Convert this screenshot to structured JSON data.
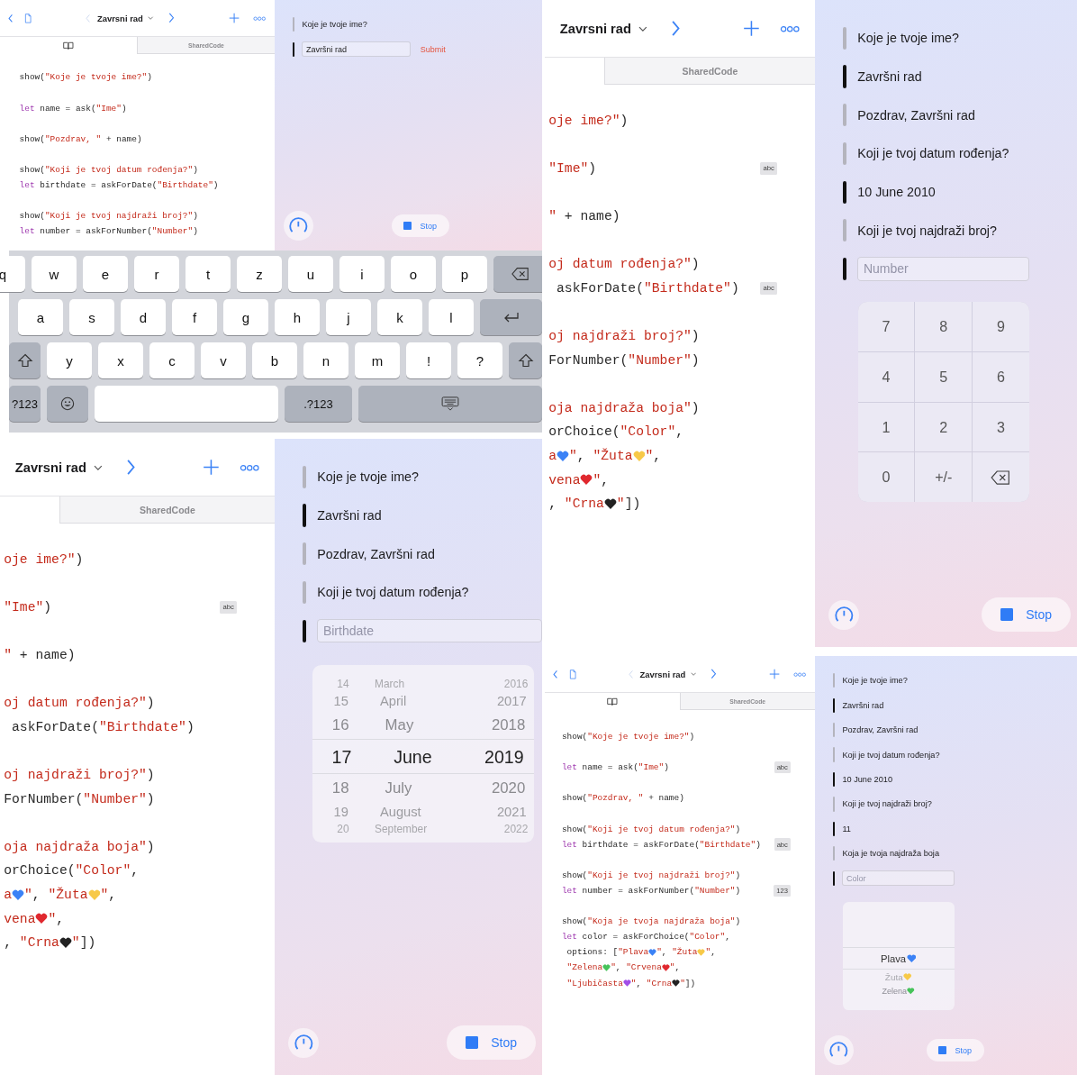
{
  "panels": [
    {
      "editor": {
        "leading_icons": true,
        "title": "Zavrsni rad",
        "tabs": [
          {
            "kind": "book",
            "selected": true
          },
          {
            "kind": "file",
            "label": "SharedCode",
            "selected": false
          }
        ],
        "blocks": [
          {
            "lines": [
              {
                "tokens": [
                  {
                    "kind": "plain",
                    "text": "show("
                  },
                  {
                    "kind": "string",
                    "text": "\"Koje je tvoje ime?\""
                  },
                  {
                    "kind": "plain",
                    "text": ")"
                  }
                ]
              }
            ]
          },
          {
            "lines": [
              {
                "tokens": [
                  {
                    "kind": "keyword",
                    "text": "let"
                  },
                  {
                    "kind": "plain",
                    "text": " name = ask("
                  },
                  {
                    "kind": "string",
                    "text": "\"Ime\""
                  },
                  {
                    "kind": "plain",
                    "text": ")"
                  }
                ]
              }
            ]
          },
          {
            "lines": [
              {
                "tokens": [
                  {
                    "kind": "plain",
                    "text": "show("
                  },
                  {
                    "kind": "string",
                    "text": "\"Pozdrav, \""
                  },
                  {
                    "kind": "plain",
                    "text": " + name)"
                  }
                ]
              }
            ]
          },
          {
            "lines": [
              {
                "tokens": [
                  {
                    "kind": "plain",
                    "text": "show("
                  },
                  {
                    "kind": "string",
                    "text": "\"Koji je tvoj datum rođenja?\""
                  },
                  {
                    "kind": "plain",
                    "text": ")"
                  }
                ]
              },
              {
                "tokens": [
                  {
                    "kind": "keyword",
                    "text": "let"
                  },
                  {
                    "kind": "plain",
                    "text": " birthdate = askForDate("
                  },
                  {
                    "kind": "string",
                    "text": "\"Birthdate\""
                  },
                  {
                    "kind": "plain",
                    "text": ")"
                  }
                ]
              }
            ]
          },
          {
            "lines": [
              {
                "tokens": [
                  {
                    "kind": "plain",
                    "text": "show("
                  },
                  {
                    "kind": "string",
                    "text": "\"Koji je tvoj najdraži broj?\""
                  },
                  {
                    "kind": "plain",
                    "text": ")"
                  }
                ]
              },
              {
                "tokens": [
                  {
                    "kind": "keyword",
                    "text": "let"
                  },
                  {
                    "kind": "plain",
                    "text": " number = askForNumber("
                  },
                  {
                    "kind": "string",
                    "text": "\"Number\""
                  },
                  {
                    "kind": "plain",
                    "text": ")"
                  }
                ]
              }
            ]
          }
        ]
      },
      "live": {
        "items": [
          {
            "kind": "output",
            "text": "Koje je tvoje ime?"
          },
          {
            "kind": "field",
            "value": "Završni rad",
            "submit": "Submit"
          }
        ],
        "stop_label": "Stop"
      },
      "keyboard": {
        "rows": [
          {
            "keys": [
              {
                "kind": "letter",
                "label": "q"
              },
              {
                "kind": "letter",
                "label": "w"
              },
              {
                "kind": "letter",
                "label": "e"
              },
              {
                "kind": "letter",
                "label": "r"
              },
              {
                "kind": "letter",
                "label": "t"
              },
              {
                "kind": "letter",
                "label": "z"
              },
              {
                "kind": "letter",
                "label": "u"
              },
              {
                "kind": "letter",
                "label": "i"
              },
              {
                "kind": "letter",
                "label": "o"
              },
              {
                "kind": "letter",
                "label": "p"
              },
              {
                "kind": "delete"
              }
            ]
          },
          {
            "keys": [
              {
                "kind": "letter",
                "label": "a"
              },
              {
                "kind": "letter",
                "label": "s"
              },
              {
                "kind": "letter",
                "label": "d"
              },
              {
                "kind": "letter",
                "label": "f"
              },
              {
                "kind": "letter",
                "label": "g"
              },
              {
                "kind": "letter",
                "label": "h"
              },
              {
                "kind": "letter",
                "label": "j"
              },
              {
                "kind": "letter",
                "label": "k"
              },
              {
                "kind": "letter",
                "label": "l"
              },
              {
                "kind": "return"
              }
            ]
          },
          {
            "keys": [
              {
                "kind": "shift"
              },
              {
                "kind": "letter",
                "label": "y"
              },
              {
                "kind": "letter",
                "label": "x"
              },
              {
                "kind": "letter",
                "label": "c"
              },
              {
                "kind": "letter",
                "label": "v"
              },
              {
                "kind": "letter",
                "label": "b"
              },
              {
                "kind": "letter",
                "label": "n"
              },
              {
                "kind": "letter",
                "label": "m"
              },
              {
                "kind": "letter",
                "label": "!"
              },
              {
                "kind": "letter",
                "label": "?"
              },
              {
                "kind": "shift"
              }
            ]
          },
          {
            "keys": [
              {
                "kind": "mode",
                "label": "?123"
              },
              {
                "kind": "emoji"
              },
              {
                "kind": "space"
              },
              {
                "kind": "mode",
                "label": ".?123"
              },
              {
                "kind": "dismiss"
              }
            ]
          }
        ]
      }
    },
    {
      "editor": {
        "leading_icons": false,
        "title": "Zavrsni rad",
        "tabs": [
          {
            "kind": "file",
            "label": "SharedCode",
            "selected": false
          }
        ],
        "blocks": [
          {
            "lines": [
              {
                "tokens": [
                  {
                    "kind": "string",
                    "text": "oje ime?\""
                  },
                  {
                    "kind": "plain",
                    "text": ")"
                  }
                ]
              }
            ]
          },
          {
            "lines": [
              {
                "tokens": [
                  {
                    "kind": "string",
                    "text": "\"Ime\""
                  },
                  {
                    "kind": "plain",
                    "text": ")"
                  }
                ],
                "badge": "abc"
              }
            ]
          },
          {
            "lines": [
              {
                "tokens": [
                  {
                    "kind": "string",
                    "text": "\""
                  },
                  {
                    "kind": "plain",
                    "text": " + name)"
                  }
                ]
              }
            ]
          },
          {
            "lines": [
              {
                "tokens": [
                  {
                    "kind": "string",
                    "text": "oj datum rođenja?\""
                  },
                  {
                    "kind": "plain",
                    "text": ")"
                  }
                ]
              },
              {
                "tokens": [
                  {
                    "kind": "plain",
                    "text": " askForDate("
                  },
                  {
                    "kind": "string",
                    "text": "\"Birthdate\""
                  },
                  {
                    "kind": "plain",
                    "text": ")"
                  }
                ],
                "badge": "abc"
              }
            ]
          },
          {
            "lines": [
              {
                "tokens": [
                  {
                    "kind": "string",
                    "text": "oj najdraži broj?\""
                  },
                  {
                    "kind": "plain",
                    "text": ")"
                  }
                ]
              },
              {
                "tokens": [
                  {
                    "kind": "plain",
                    "text": "ForNumber("
                  },
                  {
                    "kind": "string",
                    "text": "\"Number\""
                  },
                  {
                    "kind": "plain",
                    "text": ")"
                  }
                ]
              }
            ]
          },
          {
            "lines": [
              {
                "tokens": [
                  {
                    "kind": "string",
                    "text": "oja najdraža boja\""
                  },
                  {
                    "kind": "plain",
                    "text": ")"
                  }
                ]
              },
              {
                "tokens": [
                  {
                    "kind": "plain",
                    "text": "orChoice("
                  },
                  {
                    "kind": "string",
                    "text": "\"Color\""
                  },
                  {
                    "kind": "plain",
                    "text": ","
                  }
                ]
              },
              {
                "tokens": [
                  {
                    "kind": "string",
                    "text": "a"
                  },
                  {
                    "kind": "heart",
                    "color": "#3b82f6"
                  },
                  {
                    "kind": "string",
                    "text": "\""
                  },
                  {
                    "kind": "plain",
                    "text": ", "
                  },
                  {
                    "kind": "string",
                    "text": "\"Žuta"
                  },
                  {
                    "kind": "heart",
                    "color": "#f7c948"
                  },
                  {
                    "kind": "string",
                    "text": "\""
                  },
                  {
                    "kind": "plain",
                    "text": ","
                  }
                ]
              },
              {
                "tokens": [
                  {
                    "kind": "string",
                    "text": "vena"
                  },
                  {
                    "kind": "heart",
                    "color": "#e0282e"
                  },
                  {
                    "kind": "string",
                    "text": "\""
                  },
                  {
                    "kind": "plain",
                    "text": ","
                  }
                ]
              },
              {
                "tokens": [
                  {
                    "kind": "plain",
                    "text": ", "
                  },
                  {
                    "kind": "string",
                    "text": "\"Crna"
                  },
                  {
                    "kind": "heart",
                    "color": "#222222"
                  },
                  {
                    "kind": "string",
                    "text": "\""
                  },
                  {
                    "kind": "plain",
                    "text": "])"
                  }
                ]
              }
            ]
          }
        ]
      },
      "live": {
        "items": [
          {
            "kind": "output",
            "text": "Koje je tvoje ime?"
          },
          {
            "kind": "input",
            "text": "Završni rad"
          },
          {
            "kind": "output",
            "text": "Pozdrav, Završni rad"
          },
          {
            "kind": "output",
            "text": "Koji je tvoj datum rođenja?"
          },
          {
            "kind": "input",
            "text": "10 June 2010"
          },
          {
            "kind": "output",
            "text": "Koji je tvoj najdraži broj?"
          },
          {
            "kind": "field",
            "placeholder": "Number",
            "picker": {
              "kind": "numpad",
              "keys": [
                {
                  "kind": "digit",
                  "label": "7"
                },
                {
                  "kind": "digit",
                  "label": "8"
                },
                {
                  "kind": "digit",
                  "label": "9"
                },
                {
                  "kind": "digit",
                  "label": "4"
                },
                {
                  "kind": "digit",
                  "label": "5"
                },
                {
                  "kind": "digit",
                  "label": "6"
                },
                {
                  "kind": "digit",
                  "label": "1"
                },
                {
                  "kind": "digit",
                  "label": "2"
                },
                {
                  "kind": "digit",
                  "label": "3"
                },
                {
                  "kind": "digit",
                  "label": "0"
                },
                {
                  "kind": "digit",
                  "label": "+/-"
                },
                {
                  "kind": "delete"
                }
              ]
            }
          }
        ],
        "stop_label": "Stop"
      }
    },
    {
      "editor": {
        "leading_icons": false,
        "title": "Zavrsni rad",
        "tabs": [
          {
            "kind": "file",
            "label": "SharedCode",
            "selected": false
          }
        ],
        "blocks": [
          {
            "lines": [
              {
                "tokens": [
                  {
                    "kind": "string",
                    "text": "oje ime?\""
                  },
                  {
                    "kind": "plain",
                    "text": ")"
                  }
                ]
              }
            ]
          },
          {
            "lines": [
              {
                "tokens": [
                  {
                    "kind": "string",
                    "text": "\"Ime\""
                  },
                  {
                    "kind": "plain",
                    "text": ")"
                  }
                ],
                "badge": "abc"
              }
            ]
          },
          {
            "lines": [
              {
                "tokens": [
                  {
                    "kind": "string",
                    "text": "\""
                  },
                  {
                    "kind": "plain",
                    "text": " + name)"
                  }
                ]
              }
            ]
          },
          {
            "lines": [
              {
                "tokens": [
                  {
                    "kind": "string",
                    "text": "oj datum rođenja?\""
                  },
                  {
                    "kind": "plain",
                    "text": ")"
                  }
                ]
              },
              {
                "tokens": [
                  {
                    "kind": "plain",
                    "text": " askForDate("
                  },
                  {
                    "kind": "string",
                    "text": "\"Birthdate\""
                  },
                  {
                    "kind": "plain",
                    "text": ")"
                  }
                ]
              }
            ]
          },
          {
            "lines": [
              {
                "tokens": [
                  {
                    "kind": "string",
                    "text": "oj najdraži broj?\""
                  },
                  {
                    "kind": "plain",
                    "text": ")"
                  }
                ]
              },
              {
                "tokens": [
                  {
                    "kind": "plain",
                    "text": "ForNumber("
                  },
                  {
                    "kind": "string",
                    "text": "\"Number\""
                  },
                  {
                    "kind": "plain",
                    "text": ")"
                  }
                ]
              }
            ]
          },
          {
            "lines": [
              {
                "tokens": [
                  {
                    "kind": "string",
                    "text": "oja najdraža boja\""
                  },
                  {
                    "kind": "plain",
                    "text": ")"
                  }
                ]
              },
              {
                "tokens": [
                  {
                    "kind": "plain",
                    "text": "orChoice("
                  },
                  {
                    "kind": "string",
                    "text": "\"Color\""
                  },
                  {
                    "kind": "plain",
                    "text": ","
                  }
                ]
              },
              {
                "tokens": [
                  {
                    "kind": "string",
                    "text": "a"
                  },
                  {
                    "kind": "heart",
                    "color": "#3b82f6"
                  },
                  {
                    "kind": "string",
                    "text": "\""
                  },
                  {
                    "kind": "plain",
                    "text": ", "
                  },
                  {
                    "kind": "string",
                    "text": "\"Žuta"
                  },
                  {
                    "kind": "heart",
                    "color": "#f7c948"
                  },
                  {
                    "kind": "string",
                    "text": "\""
                  },
                  {
                    "kind": "plain",
                    "text": ","
                  }
                ]
              },
              {
                "tokens": [
                  {
                    "kind": "string",
                    "text": "vena"
                  },
                  {
                    "kind": "heart",
                    "color": "#e0282e"
                  },
                  {
                    "kind": "string",
                    "text": "\""
                  },
                  {
                    "kind": "plain",
                    "text": ","
                  }
                ]
              },
              {
                "tokens": [
                  {
                    "kind": "plain",
                    "text": ", "
                  },
                  {
                    "kind": "string",
                    "text": "\"Crna"
                  },
                  {
                    "kind": "heart",
                    "color": "#222222"
                  },
                  {
                    "kind": "string",
                    "text": "\""
                  },
                  {
                    "kind": "plain",
                    "text": "])"
                  }
                ]
              }
            ]
          }
        ]
      },
      "live": {
        "items": [
          {
            "kind": "output",
            "text": "Koje je tvoje ime?"
          },
          {
            "kind": "input",
            "text": "Završni rad"
          },
          {
            "kind": "output",
            "text": "Pozdrav, Završni rad"
          },
          {
            "kind": "output",
            "text": "Koji je tvoj datum rođenja?"
          },
          {
            "kind": "field",
            "placeholder": "Birthdate",
            "picker": {
              "kind": "date",
              "rows": [
                {
                  "day": "14",
                  "month": "March",
                  "year": "2016",
                  "selected": false
                },
                {
                  "day": "15",
                  "month": "April",
                  "year": "2017",
                  "selected": false
                },
                {
                  "day": "16",
                  "month": "May",
                  "year": "2018",
                  "selected": false
                },
                {
                  "day": "17",
                  "month": "June",
                  "year": "2019",
                  "selected": true
                },
                {
                  "day": "18",
                  "month": "July",
                  "year": "2020",
                  "selected": false
                },
                {
                  "day": "19",
                  "month": "August",
                  "year": "2021",
                  "selected": false
                },
                {
                  "day": "20",
                  "month": "September",
                  "year": "2022",
                  "selected": false
                }
              ]
            }
          }
        ],
        "stop_label": "Stop"
      }
    },
    {
      "editor": {
        "leading_icons": true,
        "title": "Zavrsni rad",
        "tabs": [
          {
            "kind": "book",
            "selected": true
          },
          {
            "kind": "file",
            "label": "SharedCode",
            "selected": false
          }
        ],
        "blocks": [
          {
            "lines": [
              {
                "tokens": [
                  {
                    "kind": "plain",
                    "text": "show("
                  },
                  {
                    "kind": "string",
                    "text": "\"Koje je tvoje ime?\""
                  },
                  {
                    "kind": "plain",
                    "text": ")"
                  }
                ]
              }
            ]
          },
          {
            "lines": [
              {
                "tokens": [
                  {
                    "kind": "keyword",
                    "text": "let"
                  },
                  {
                    "kind": "plain",
                    "text": " name = ask("
                  },
                  {
                    "kind": "string",
                    "text": "\"Ime\""
                  },
                  {
                    "kind": "plain",
                    "text": ")"
                  }
                ],
                "badge": "abc"
              }
            ]
          },
          {
            "lines": [
              {
                "tokens": [
                  {
                    "kind": "plain",
                    "text": "show("
                  },
                  {
                    "kind": "string",
                    "text": "\"Pozdrav, \""
                  },
                  {
                    "kind": "plain",
                    "text": " + name)"
                  }
                ]
              }
            ]
          },
          {
            "lines": [
              {
                "tokens": [
                  {
                    "kind": "plain",
                    "text": "show("
                  },
                  {
                    "kind": "string",
                    "text": "\"Koji je tvoj datum rođenja?\""
                  },
                  {
                    "kind": "plain",
                    "text": ")"
                  }
                ]
              },
              {
                "tokens": [
                  {
                    "kind": "keyword",
                    "text": "let"
                  },
                  {
                    "kind": "plain",
                    "text": " birthdate = askForDate("
                  },
                  {
                    "kind": "string",
                    "text": "\"Birthdate\""
                  },
                  {
                    "kind": "plain",
                    "text": ")"
                  }
                ],
                "badge": "abc"
              }
            ]
          },
          {
            "lines": [
              {
                "tokens": [
                  {
                    "kind": "plain",
                    "text": "show("
                  },
                  {
                    "kind": "string",
                    "text": "\"Koji je tvoj najdraži broj?\""
                  },
                  {
                    "kind": "plain",
                    "text": ")"
                  }
                ]
              },
              {
                "tokens": [
                  {
                    "kind": "keyword",
                    "text": "let"
                  },
                  {
                    "kind": "plain",
                    "text": " number = askForNumber("
                  },
                  {
                    "kind": "string",
                    "text": "\"Number\""
                  },
                  {
                    "kind": "plain",
                    "text": ")"
                  }
                ],
                "badge": "123"
              }
            ]
          },
          {
            "lines": [
              {
                "tokens": [
                  {
                    "kind": "plain",
                    "text": "show("
                  },
                  {
                    "kind": "string",
                    "text": "\"Koja je tvoja najdraža boja\""
                  },
                  {
                    "kind": "plain",
                    "text": ")"
                  }
                ]
              },
              {
                "tokens": [
                  {
                    "kind": "keyword",
                    "text": "let"
                  },
                  {
                    "kind": "plain",
                    "text": " color = askForChoice("
                  },
                  {
                    "kind": "string",
                    "text": "\"Color\""
                  },
                  {
                    "kind": "plain",
                    "text": ","
                  }
                ]
              },
              {
                "tokens": [
                  {
                    "kind": "plain",
                    "text": " options: ["
                  },
                  {
                    "kind": "string",
                    "text": "\"Plava"
                  },
                  {
                    "kind": "heart",
                    "color": "#3b82f6"
                  },
                  {
                    "kind": "string",
                    "text": "\""
                  },
                  {
                    "kind": "plain",
                    "text": ", "
                  },
                  {
                    "kind": "string",
                    "text": "\"Žuta"
                  },
                  {
                    "kind": "heart",
                    "color": "#f7c948"
                  },
                  {
                    "kind": "string",
                    "text": "\""
                  },
                  {
                    "kind": "plain",
                    "text": ","
                  }
                ]
              },
              {
                "tokens": [
                  {
                    "kind": "string",
                    "text": " \"Zelena"
                  },
                  {
                    "kind": "heart",
                    "color": "#46c35a"
                  },
                  {
                    "kind": "string",
                    "text": "\""
                  },
                  {
                    "kind": "plain",
                    "text": ", "
                  },
                  {
                    "kind": "string",
                    "text": "\"Crvena"
                  },
                  {
                    "kind": "heart",
                    "color": "#e0282e"
                  },
                  {
                    "kind": "string",
                    "text": "\""
                  },
                  {
                    "kind": "plain",
                    "text": ","
                  }
                ]
              },
              {
                "tokens": [
                  {
                    "kind": "string",
                    "text": " \"Ljubičasta"
                  },
                  {
                    "kind": "heart",
                    "color": "#a24de8"
                  },
                  {
                    "kind": "string",
                    "text": "\""
                  },
                  {
                    "kind": "plain",
                    "text": ", "
                  },
                  {
                    "kind": "string",
                    "text": "\"Crna"
                  },
                  {
                    "kind": "heart",
                    "color": "#222222"
                  },
                  {
                    "kind": "string",
                    "text": "\""
                  },
                  {
                    "kind": "plain",
                    "text": "])"
                  }
                ]
              }
            ]
          }
        ]
      },
      "live": {
        "items": [
          {
            "kind": "output",
            "text": "Koje je tvoje ime?"
          },
          {
            "kind": "input",
            "text": "Završni rad"
          },
          {
            "kind": "output",
            "text": "Pozdrav, Završni rad"
          },
          {
            "kind": "output",
            "text": "Koji je tvoj datum rođenja?"
          },
          {
            "kind": "input",
            "text": "10 June 2010"
          },
          {
            "kind": "output",
            "text": "Koji je tvoj najdraži broj?"
          },
          {
            "kind": "input",
            "text": "11"
          },
          {
            "kind": "output",
            "text": "Koja je tvoja najdraža boja"
          },
          {
            "kind": "field",
            "placeholder": "Color",
            "picker": {
              "kind": "choice",
              "options": [
                {
                  "label": "Plava",
                  "color": "#3b82f6",
                  "selected": true
                },
                {
                  "label": "Žuta",
                  "color": "#f7c948",
                  "selected": false
                },
                {
                  "label": "Zelena",
                  "color": "#46c35a",
                  "selected": false
                }
              ]
            }
          }
        ],
        "stop_label": "Stop"
      }
    }
  ]
}
